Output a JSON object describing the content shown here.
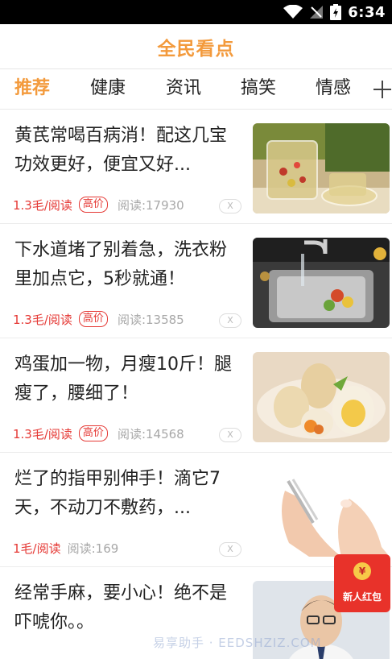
{
  "status_bar": {
    "time": "6:34"
  },
  "header": {
    "title": "全民看点"
  },
  "tabs": [
    {
      "label": "推荐",
      "active": true
    },
    {
      "label": "健康",
      "active": false
    },
    {
      "label": "资讯",
      "active": false
    },
    {
      "label": "搞笑",
      "active": false
    },
    {
      "label": "情感",
      "active": false
    }
  ],
  "feed": [
    {
      "title": "黄芪常喝百病消！配这几宝功效更好，便宜又好...",
      "price": "1.3毛/阅读",
      "tag": "高价",
      "reads": "阅读:17930",
      "close": "X",
      "image": "herbal-tea"
    },
    {
      "title": "下水道堵了别着急，洗衣粉里加点它，5秒就通！",
      "price": "1.3毛/阅读",
      "tag": "高价",
      "reads": "阅读:13585",
      "close": "X",
      "image": "kitchen-sink"
    },
    {
      "title": "鸡蛋加一物，月瘦10斤！腿瘦了，腰细了！",
      "price": "1.3毛/阅读",
      "tag": "高价",
      "reads": "阅读:14568",
      "close": "X",
      "image": "boiled-eggs"
    },
    {
      "title": "烂了的指甲别伸手！滴它7天，不动刀不敷药，...",
      "price": "1毛/阅读",
      "tag": "",
      "reads": "阅读:169",
      "close": "X",
      "image": "nail-tweezers"
    },
    {
      "title": "经常手麻，要小心！绝不是吓唬你。。",
      "price": "",
      "tag": "",
      "reads": "",
      "close": "",
      "image": "doctor"
    }
  ],
  "red_packet": {
    "coin": "¥",
    "label": "新人红包"
  },
  "watermark": "易享助手 · EEDSHZIZ.COM",
  "colors": {
    "accent": "#f39a3c",
    "price": "#e53935",
    "red_packet": "#e8322a"
  }
}
